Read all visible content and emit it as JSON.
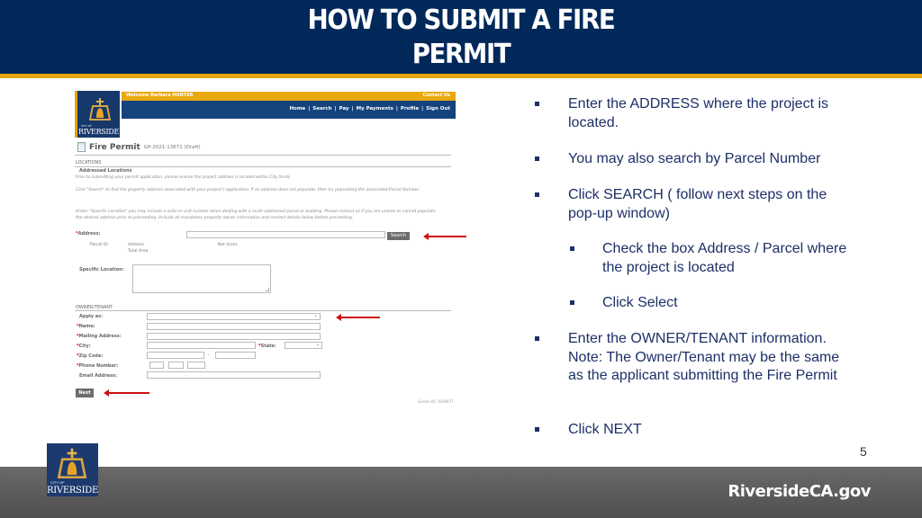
{
  "slide": {
    "title_line1": "HOW TO SUBMIT A FIRE",
    "title_line2": "PERMIT",
    "page_number": "5",
    "footer_url": "RiversideCA.gov",
    "logo_city_of": "CITY OF",
    "logo_name": "RIVERSIDE"
  },
  "screenshot": {
    "welcome": "Welcome Barbara HUNTER",
    "contact": "Contact Us",
    "nav": [
      "Home",
      "Search",
      "Pay",
      "My Payments",
      "Profile",
      "Sign Out"
    ],
    "nav_separator": "|",
    "permit_title": "Fire Permit",
    "permit_id": "GP-2021-13671 (Draft)",
    "locations": {
      "section": "LOCATIONS",
      "subsection": "Addressed Locations",
      "info1": "Prior to submitting your permit application, please ensure the project address is located within City limits.",
      "info2": "Click \"Search\" to find the property address associated with your project's application. If an address does not populate, then try populating the associated Parcel Number.",
      "info3": "Under \"Specific Location\" you may include a suite or unit number when dealing with a multi-addressed parcel or building. Please contact us if you are unsure or cannot populate the desired address prior to proceeding. Include all mandatory property owner information and contact details below before proceeding.",
      "address_label": "Address:",
      "address_value": "",
      "search_button": "Search",
      "columns": [
        "Parcel ID",
        "Address",
        "Net Acres"
      ],
      "total_area": "Total Area:",
      "specific_location_label": "Specific Location:"
    },
    "owner": {
      "section": "OWNER/TENANT",
      "apply_as": "Apply as:",
      "name": "Name:",
      "mailing": "Mailing Address:",
      "city": "City:",
      "state": "State:",
      "zip": "Zip Code:",
      "zip_sep": "-",
      "phone": "Phone Number:",
      "email": "Email Address:",
      "required_mark": "*"
    },
    "next_button": "Next",
    "screen_id": "Screen ID: 1029477"
  },
  "instructions": [
    {
      "text": "Enter the ADDRESS where the project is located.",
      "level": 1
    },
    {
      "text": "You may also search by Parcel Number",
      "level": 1
    },
    {
      "text": "Click SEARCH ( follow next steps on the pop-up window)",
      "level": 1
    },
    {
      "text": "Check the box Address / Parcel where the project is located",
      "level": 2
    },
    {
      "text": "Click Select",
      "level": 2
    },
    {
      "text": "Enter the OWNER/TENANT information. Note: The Owner/Tenant may be the same as the applicant submitting the Fire Permit",
      "level": 1
    },
    {
      "text": "Click NEXT",
      "level": 1
    }
  ],
  "colors": {
    "header_navy": "#00295a",
    "accent_gold": "#e7a70d",
    "bullet_text": "#1d2f66",
    "arrow_red": "#cc1111"
  }
}
